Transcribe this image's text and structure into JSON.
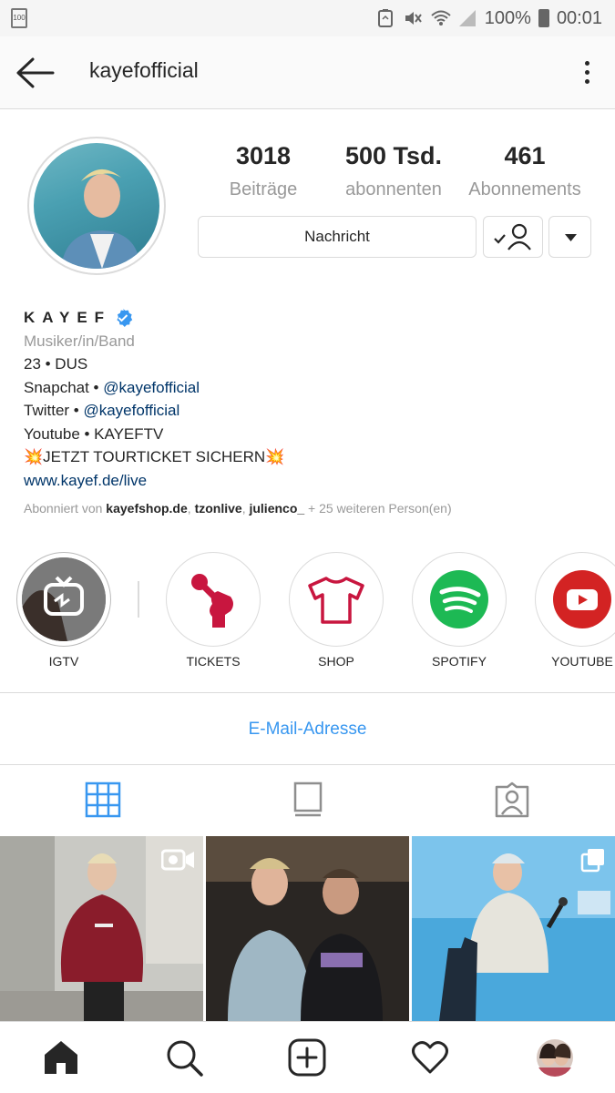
{
  "status_bar": {
    "battery_small": "100",
    "battery_percent": "100%",
    "time": "00:01"
  },
  "header": {
    "username": "kayefofficial",
    "icons": [
      "back-arrow-icon",
      "more-vertical-icon"
    ]
  },
  "profile": {
    "stats": [
      {
        "value": "3018",
        "label": "Beiträge"
      },
      {
        "value": "500 Tsd.",
        "label": "abonnenten"
      },
      {
        "value": "461",
        "label": "Abonnements"
      }
    ],
    "message_button": "Nachricht"
  },
  "bio": {
    "name": "KAYEF",
    "category": "Musiker/in/Band",
    "line1": "23 • DUS",
    "snapchat_prefix": "Snapchat • ",
    "snapchat_handle": "@kayefofficial",
    "twitter_prefix": "Twitter • ",
    "twitter_handle": "@kayefofficial",
    "youtube": "Youtube • KAYEFTV",
    "tour": "💥JETZT TOURTICKET SICHERN💥",
    "website": "www.kayef.de/live",
    "followed_prefix": "Abonniert von ",
    "followed_1": "kayefshop.de",
    "followed_sep1": ", ",
    "followed_2": "tzonlive",
    "followed_sep2": ", ",
    "followed_3": "julienco_",
    "followed_suffix": " + 25 weiteren Person(en)"
  },
  "highlights": [
    {
      "label": "IGTV",
      "icon": "igtv-icon"
    },
    {
      "label": "TICKETS",
      "icon": "microphone-fist-icon"
    },
    {
      "label": "SHOP",
      "icon": "tshirt-icon"
    },
    {
      "label": "SPOTIFY",
      "icon": "spotify-icon"
    },
    {
      "label": "YOUTUBE",
      "icon": "youtube-icon"
    }
  ],
  "email_button": "E-Mail-Adresse",
  "colors": {
    "accent_blue": "#3897f0",
    "link_blue": "#003569",
    "tickets_red": "#c8163f",
    "spotify_green": "#1db954",
    "youtube_red": "#d32323"
  },
  "nav_icons": [
    "home-icon",
    "search-icon",
    "add-post-icon",
    "heart-icon",
    "profile-avatar"
  ]
}
